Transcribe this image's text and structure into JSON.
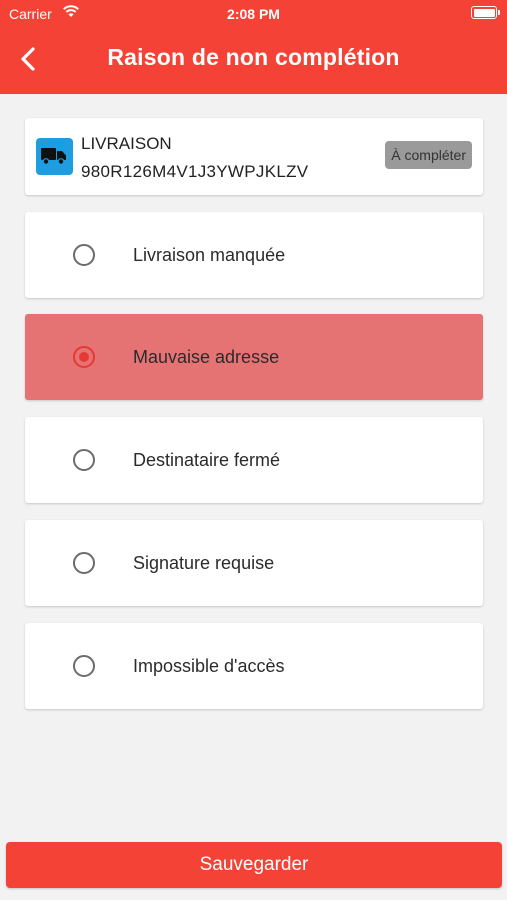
{
  "status_bar": {
    "carrier": "Carrier",
    "time": "2:08 PM"
  },
  "header": {
    "title": "Raison de non complétion",
    "back_icon": "chevron-left-icon"
  },
  "shipment": {
    "type": "LIVRAISON",
    "code": "980R126M4V1J3YWPJKLZV",
    "status": "À compléter",
    "icon": "truck-icon"
  },
  "options": [
    {
      "label": "Livraison manquée",
      "selected": false
    },
    {
      "label": "Mauvaise adresse",
      "selected": true
    },
    {
      "label": "Destinataire fermé",
      "selected": false
    },
    {
      "label": "Signature requise",
      "selected": false
    },
    {
      "label": "Impossible d'accès",
      "selected": false
    }
  ],
  "save_label": "Sauvegarder",
  "colors": {
    "accent": "#f44336",
    "selected_bg": "#e57373",
    "icon_bg": "#1e9de0"
  }
}
